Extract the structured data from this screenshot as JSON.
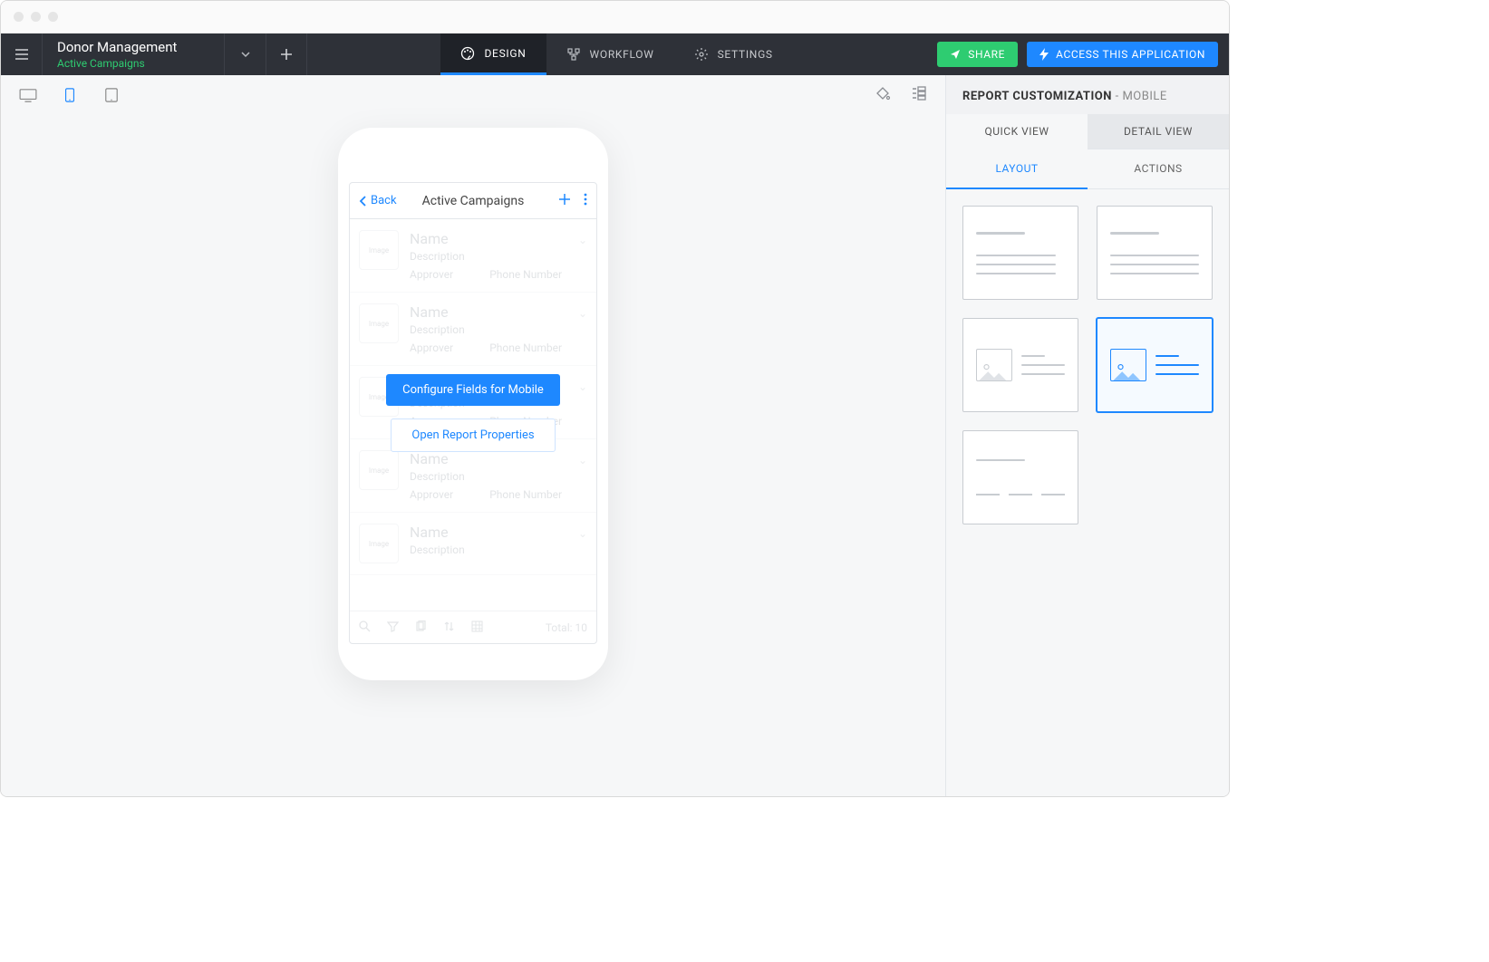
{
  "app": {
    "title": "Donor Management",
    "subtitle": "Active Campaigns"
  },
  "nav": {
    "design": "DESIGN",
    "workflow": "WORKFLOW",
    "settings": "SETTINGS"
  },
  "buttons": {
    "share": "SHARE",
    "access": "ACCESS THIS APPLICATION"
  },
  "phone": {
    "back": "Back",
    "title": "Active Campaigns",
    "row": {
      "image": "Image",
      "name": "Name",
      "description": "Description",
      "approver": "Approver",
      "phone": "Phone Number"
    },
    "total_label": "Total:",
    "total_value": "10",
    "overlay": {
      "configure": "Configure Fields for Mobile",
      "open": "Open Report Properties"
    }
  },
  "panel": {
    "title": "REPORT CUSTOMIZATION",
    "title_suffix": "- MOBILE",
    "view_tabs": {
      "quick": "QUICK VIEW",
      "detail": "DETAIL VIEW"
    },
    "sub_tabs": {
      "layout": "LAYOUT",
      "actions": "ACTIONS"
    }
  }
}
